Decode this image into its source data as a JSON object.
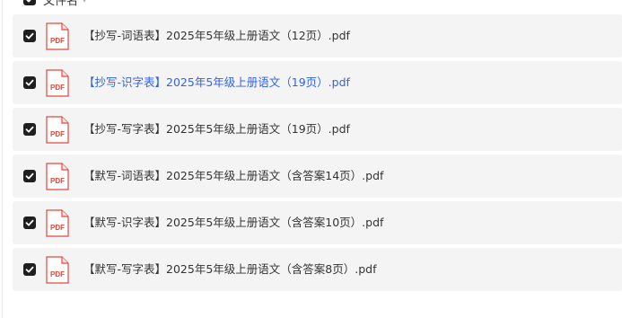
{
  "header": {
    "column_label": "文件名",
    "sort_icon": "caret-down-icon",
    "select_all_checked": true
  },
  "files": [
    {
      "name": "【抄写-词语表】2025年5年级上册语文（12页）.pdf",
      "checked": true,
      "icon": "pdf-file-icon",
      "icon_text": "PDF",
      "highlighted": false
    },
    {
      "name": "【抄写-识字表】2025年5年级上册语文（19页）.pdf",
      "checked": true,
      "icon": "pdf-file-icon",
      "icon_text": "PDF",
      "highlighted": true
    },
    {
      "name": "【抄写-写字表】2025年5年级上册语文（19页）.pdf",
      "checked": true,
      "icon": "pdf-file-icon",
      "icon_text": "PDF",
      "highlighted": false
    },
    {
      "name": "【默写-词语表】2025年5年级上册语文（含答案14页）.pdf",
      "checked": true,
      "icon": "pdf-file-icon",
      "icon_text": "PDF",
      "highlighted": false
    },
    {
      "name": "【默写-识字表】2025年5年级上册语文（含答案10页）.pdf",
      "checked": true,
      "icon": "pdf-file-icon",
      "icon_text": "PDF",
      "highlighted": false
    },
    {
      "name": "【默写-写字表】2025年5年级上册语文（含答案8页）.pdf",
      "checked": true,
      "icon": "pdf-file-icon",
      "icon_text": "PDF",
      "highlighted": false
    }
  ],
  "colors": {
    "row_background": "#f4f4f4",
    "checkbox": "#1f1f1f",
    "link_highlight": "#2f62e5",
    "pdf_red": "#e5483b"
  }
}
